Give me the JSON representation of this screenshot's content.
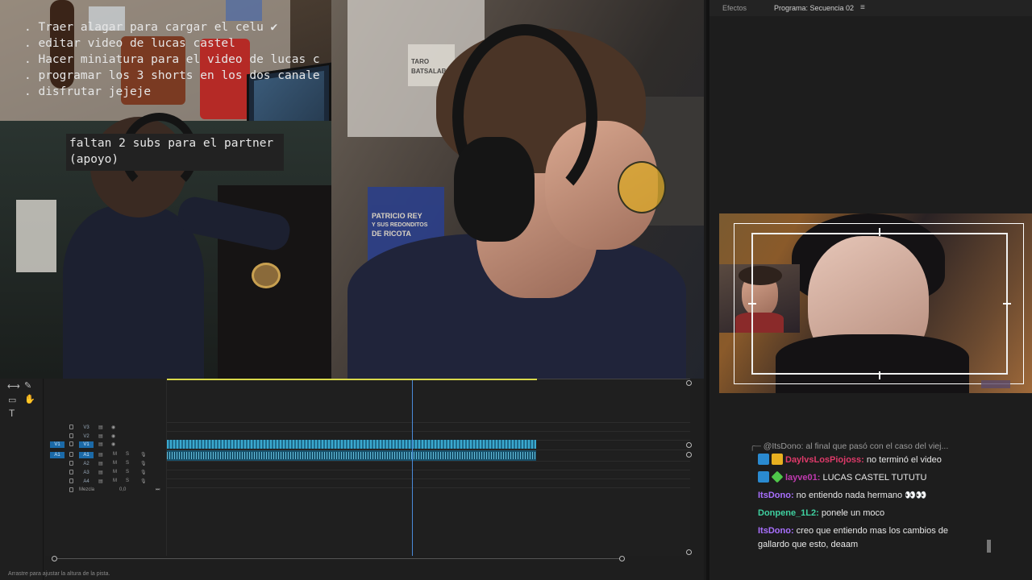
{
  "panel_tabs": {
    "effects": "Efectos",
    "program": "Programa: Secuencia 02",
    "menu_icon": "hamburger-menu-icon"
  },
  "todo": [
    {
      "text": ". Traer alagar para cargar el celu",
      "check": "✔"
    },
    {
      "text": ". editar video de lucas castel",
      "check": ""
    },
    {
      "text": ". Hacer miniatura para el video de lucas c",
      "check": ""
    },
    {
      "text": ". programar los 3 shorts en los dos canale",
      "check": ""
    },
    {
      "text": ". disfrutar jejeje",
      "check": ""
    }
  ],
  "subs_note": {
    "line1": "faltan 2 subs para el partner",
    "line2": "(apoyo)"
  },
  "posters": {
    "book_line1": "PATRICIO REY",
    "book_line2": "Y SUS REDONDITOS",
    "book_line3": "DE RICOTA",
    "sticker": "TARO BATSALAB"
  },
  "chat": [
    {
      "reply": true,
      "user": "@ItsDono:",
      "text": "al final que pasó con el caso del viej...",
      "color": "#9a9a9a"
    },
    {
      "badges": [
        "mod",
        "crown"
      ],
      "user": "DaylvsLosPiojoss:",
      "text": "no terminó el video",
      "color": "#e03a6a"
    },
    {
      "badges": [
        "mod",
        "gem"
      ],
      "user": "layve01:",
      "text": "LUCAS CASTEL TUTUTU",
      "color": "#c03ab0"
    },
    {
      "user": "ItsDono:",
      "text": "no entiendo nada hermano 👀👀",
      "color": "#a970ff"
    },
    {
      "user": "Donpene_1L2:",
      "text": "ponele un moco",
      "color": "#3fd0a0"
    },
    {
      "user": "ItsDono:",
      "text": "creo que entiendo mas los cambios de",
      "text2": "gallardo que esto, deaam",
      "color": "#a970ff"
    }
  ],
  "timeline": {
    "tracks": [
      {
        "tag": "V3",
        "src": "",
        "kind": "video"
      },
      {
        "tag": "V2",
        "src": "",
        "kind": "video"
      },
      {
        "tag": "V1",
        "src": "V1",
        "kind": "video"
      },
      {
        "tag": "A1",
        "src": "A1",
        "kind": "audio"
      },
      {
        "tag": "A2",
        "src": "",
        "kind": "audio"
      },
      {
        "tag": "A3",
        "src": "",
        "kind": "audio"
      },
      {
        "tag": "A4",
        "src": "",
        "kind": "audio"
      }
    ],
    "mix_label": "Mezcla",
    "mix_value": "0,0",
    "mute": "M",
    "solo": "S",
    "status_text": "Arrastre para ajustar la altura de la pista."
  }
}
